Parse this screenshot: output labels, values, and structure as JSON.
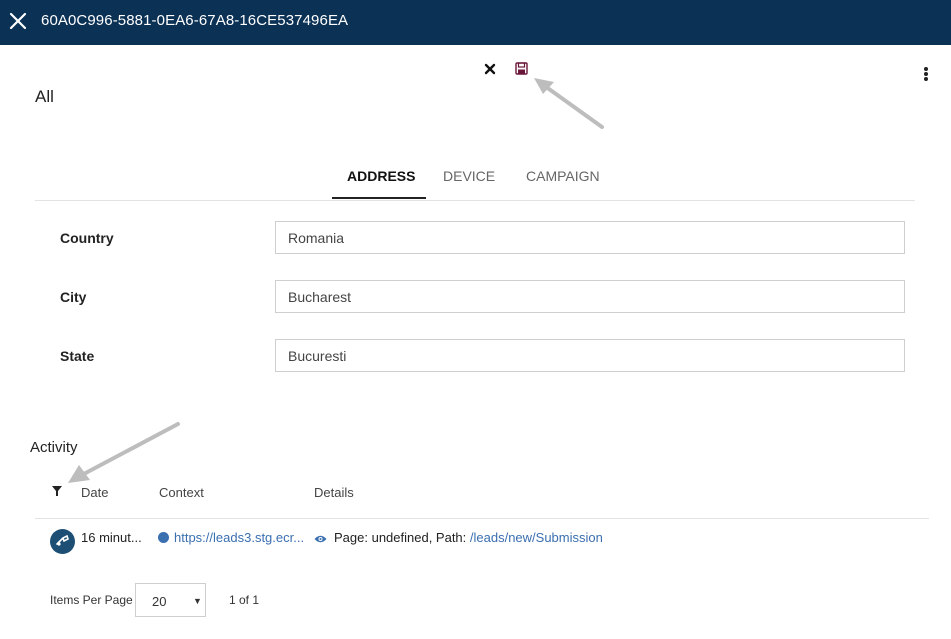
{
  "header": {
    "title": "60A0C996-5881-0EA6-67A8-16CE537496EA",
    "close_icon": "close-icon",
    "bg_color": "#0b3155"
  },
  "toolbar": {
    "discard_icon": "x-icon",
    "save_icon": "floppy-disk-icon",
    "menu_icon": "kebab-menu-icon"
  },
  "view": {
    "title": "All"
  },
  "tabs": [
    {
      "label": "ADDRESS",
      "active": true
    },
    {
      "label": "DEVICE",
      "active": false
    },
    {
      "label": "CAMPAIGN",
      "active": false
    }
  ],
  "address": {
    "fields": [
      {
        "label": "Country",
        "value": "Romania"
      },
      {
        "label": "City",
        "value": "Bucharest"
      },
      {
        "label": "State",
        "value": "Bucuresti"
      }
    ]
  },
  "activity": {
    "title": "Activity",
    "filter_icon": "filter-icon",
    "columns": [
      "Date",
      "Context",
      "Details"
    ],
    "rows": [
      {
        "date": "16 minut...",
        "context": "https://leads3.stg.ecr...",
        "details_prefix": "Page: undefined, Path: ",
        "details_link": "/leads/new/Submission",
        "context_icon": "globe-icon",
        "details_icon": "eye-icon",
        "avatar_icon": "activity-type-icon"
      }
    ]
  },
  "pager": {
    "items_per_page_label": "Items Per Page",
    "items_per_page_value": "20",
    "page_count": "1 of 1"
  },
  "link_color": "#3a6fb0"
}
